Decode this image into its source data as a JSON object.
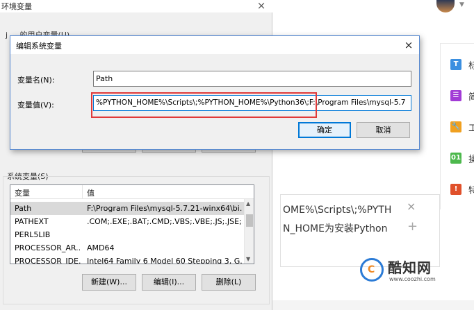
{
  "env_window": {
    "title": "环境变量",
    "close_glyph": "×",
    "user_vars_fragment": "j ... 的用户变量(U)"
  },
  "system_vars": {
    "label": "系统变量(S)",
    "columns": [
      "变量",
      "值"
    ],
    "rows": [
      {
        "name": "Path",
        "value": "F:\\Program Files\\mysql-5.7.21-winx64\\bi..."
      },
      {
        "name": "PATHEXT",
        "value": ".COM;.EXE;.BAT;.CMD;.VBS;.VBE;.JS;.JSE;..."
      },
      {
        "name": "PERL5LIB",
        "value": ""
      },
      {
        "name": "PROCESSOR_AR...",
        "value": "AMD64"
      },
      {
        "name": "PROCESSOR_IDE...",
        "value": "Intel64 Family 6 Model 60 Stepping 3, G..."
      }
    ],
    "buttons": {
      "new": "新建(W)...",
      "edit": "编辑(I)...",
      "delete": "删除(L)"
    }
  },
  "dialog": {
    "title": "编辑系统变量",
    "close_glyph": "×",
    "name_label": "变量名(N):",
    "name_value": "Path",
    "value_label": "变量值(V):",
    "value_value": "%PYTHON_HOME%\\Scripts\\;%PYTHON_HOME%\\Python36\\;F:\\Program Files\\mysql-5.7",
    "ok_label": "确定",
    "cancel_label": "取消",
    "highlight_color": "#e03a3a",
    "accent_color": "#0078d7"
  },
  "side_panel": {
    "items": [
      {
        "icon": "T",
        "label": "标",
        "color": "#3b8fe0",
        "icon_name": "text-icon"
      },
      {
        "icon": "☰",
        "label": "简",
        "color": "#a23bd6",
        "icon_name": "list-icon"
      },
      {
        "icon": "🔧",
        "label": "工",
        "color": "#f0a020",
        "icon_name": "wrench-icon"
      },
      {
        "icon": "01",
        "label": "操",
        "color": "#4cb84c",
        "icon_name": "steps-icon"
      },
      {
        "icon": "!",
        "label": "特",
        "color": "#e0502a",
        "icon_name": "warning-icon"
      }
    ]
  },
  "snippet": {
    "line1": "OME%\\Scripts\\;%PYTH",
    "line2": "N_HOME为安装Python",
    "close_glyph": "×",
    "add_glyph": "+"
  },
  "watermark": {
    "logo_letter": "C",
    "name": "酷知网",
    "url": "www.coozhi.com"
  }
}
